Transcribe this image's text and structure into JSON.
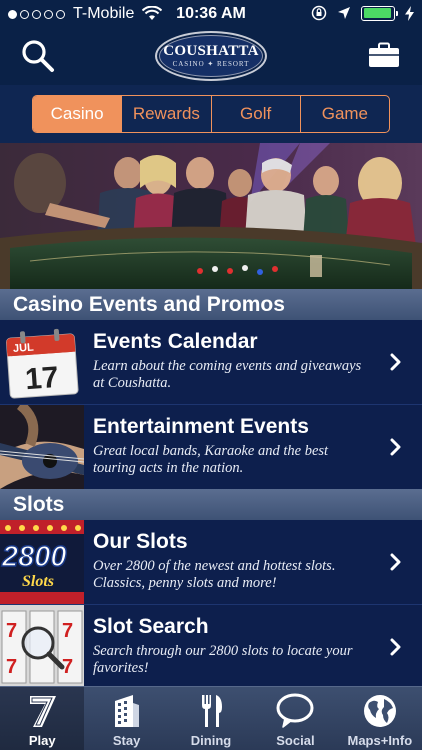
{
  "status_bar": {
    "carrier": "T-Mobile",
    "time": "10:36 AM",
    "signal_dots_filled": 1,
    "signal_dots_total": 5,
    "battery_level": 0.95,
    "battery_color": "#4cd964",
    "icons": [
      "wifi-icon",
      "rotation-lock-icon",
      "location-arrow-icon",
      "battery-icon",
      "charging-bolt-icon"
    ]
  },
  "header": {
    "logo_title": "COUSHATTA",
    "logo_subtitle": "CASINO ✦ RESORT",
    "left_icon": "search-icon",
    "right_icon": "briefcase-icon"
  },
  "tabs": {
    "items": [
      {
        "label": "Casino",
        "active": true
      },
      {
        "label": "Rewards",
        "active": false
      },
      {
        "label": "Golf",
        "active": false
      },
      {
        "label": "Game",
        "active": false
      }
    ],
    "accent": "#f0925c"
  },
  "sections": [
    {
      "title": "Casino Events and Promos",
      "rows": [
        {
          "title": "Events Calendar",
          "description": "Learn about the coming events and giveaways at Coushatta.",
          "thumb": "calendar",
          "calendar_month": "JUL",
          "calendar_day": "17"
        },
        {
          "title": "Entertainment Events",
          "description": "Great local bands, Karaoke and the best touring acts in the nation.",
          "thumb": "guitar"
        }
      ]
    },
    {
      "title": "Slots",
      "rows": [
        {
          "title": "Our Slots",
          "description": "Over 2800 of the newest and hottest slots. Classics, penny slots and more!",
          "thumb": "slots",
          "thumb_text": "2800",
          "thumb_subtext": "Slots"
        },
        {
          "title": "Slot Search",
          "description": "Search through our 2800 slots to locate your favorites!",
          "thumb": "slot-search"
        }
      ]
    }
  ],
  "tabbar": {
    "items": [
      {
        "label": "Play",
        "icon": "seven-icon",
        "active": true
      },
      {
        "label": "Stay",
        "icon": "building-icon",
        "active": false
      },
      {
        "label": "Dining",
        "icon": "fork-knife-icon",
        "active": false
      },
      {
        "label": "Social",
        "icon": "speech-bubble-icon",
        "active": false
      },
      {
        "label": "Maps+Info",
        "icon": "globe-icon",
        "active": false
      }
    ]
  }
}
